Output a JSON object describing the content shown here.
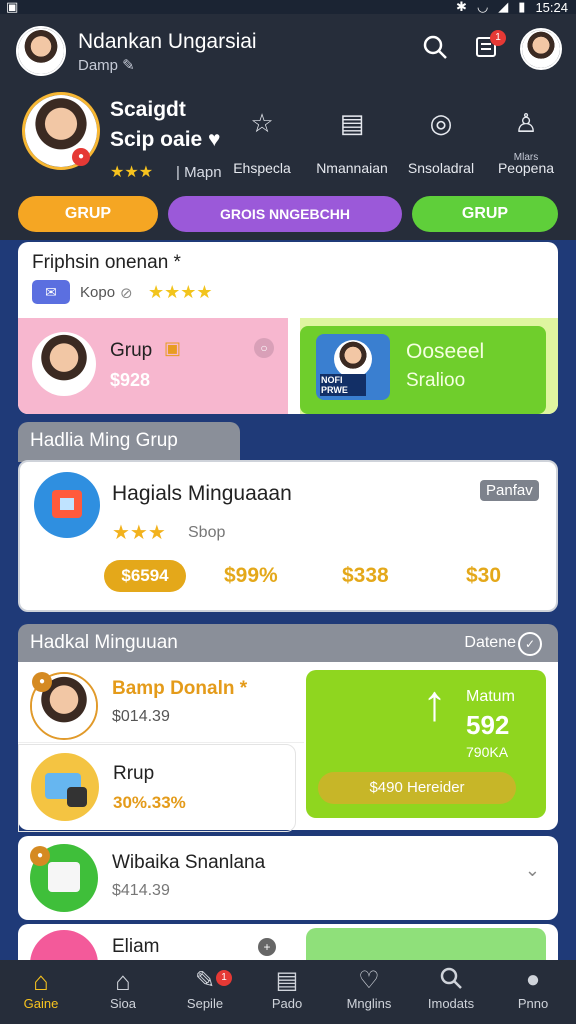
{
  "status_bar": {
    "time": "15:24",
    "left_icon": "image-icon"
  },
  "app_bar": {
    "title": "Ndankan Ungarsiai",
    "subtitle": "Damp ✎",
    "notif_count": "1"
  },
  "profile": {
    "name_line1": "Scaigdt",
    "name_line2": "Scip oaie ♥",
    "stars": "★★★",
    "map_label": "| Mapn",
    "quick_actions": [
      {
        "icon": "star-outline-icon",
        "label": "Ehspecla"
      },
      {
        "icon": "document-icon",
        "label": "Nmannaian"
      },
      {
        "icon": "compass-icon",
        "label": "Snsoladral"
      },
      {
        "icon": "person-icon",
        "label": "Peopena",
        "sublabel": "Mlars"
      }
    ]
  },
  "pills": [
    {
      "label": "GRUP",
      "color": "#f5a623"
    },
    {
      "label": "GROIS NNGEBCHH",
      "color": "#9b59d9"
    },
    {
      "label": "GRUP",
      "color": "#5fcf3a"
    }
  ],
  "friend_card": {
    "title": "Friphsin onenan *",
    "kopo": "Kopo",
    "stars": "★★★★",
    "pink_tile": {
      "name": "Grup",
      "value": "$928"
    },
    "green_tile": {
      "name": "Ooseeel",
      "sub": "Sralioo",
      "photo_caption": "NOFI PRWE"
    }
  },
  "weekly": {
    "header": "Hadlia Ming Grup",
    "title": "Hagials Minguaaan",
    "tag": "Panfav",
    "stars": "★★★",
    "sub": "Sbop",
    "prices": [
      "$6594",
      "$99%",
      "$338",
      "$30"
    ]
  },
  "ranking": {
    "header": "Hadkal Minguuan",
    "header_action": "Datene",
    "items": [
      {
        "name": "Bamp Donaln *",
        "value": "$014.39"
      },
      {
        "name": "Rrup",
        "value": "30%.33%"
      },
      {
        "name": "Wibaika Snanlana",
        "value": "$414.39"
      },
      {
        "name": "Eliam",
        "value": ""
      }
    ],
    "promo": {
      "label": "Matum",
      "number": "592",
      "sub": "790KA",
      "button": "$490 Hereider"
    }
  },
  "bottom_nav": [
    {
      "label": "Gaine",
      "icon": "home-icon",
      "active": true
    },
    {
      "label": "Sioa",
      "icon": "house-icon",
      "active": false
    },
    {
      "label": "Sepile",
      "icon": "edit-icon",
      "active": false,
      "badge": "1"
    },
    {
      "label": "Pado",
      "icon": "notes-icon",
      "active": false
    },
    {
      "label": "Mnglins",
      "icon": "heart-icon",
      "active": false
    },
    {
      "label": "Imodats",
      "icon": "search-icon",
      "active": false
    },
    {
      "label": "Pnno",
      "icon": "profile-icon",
      "active": false
    }
  ],
  "colors": {
    "accent_yellow": "#f7c31f",
    "price_orange": "#e4a81a",
    "promo_green": "#8fd61f",
    "pink": "#f7b7cf",
    "bottom_bar": "#262d3a"
  }
}
